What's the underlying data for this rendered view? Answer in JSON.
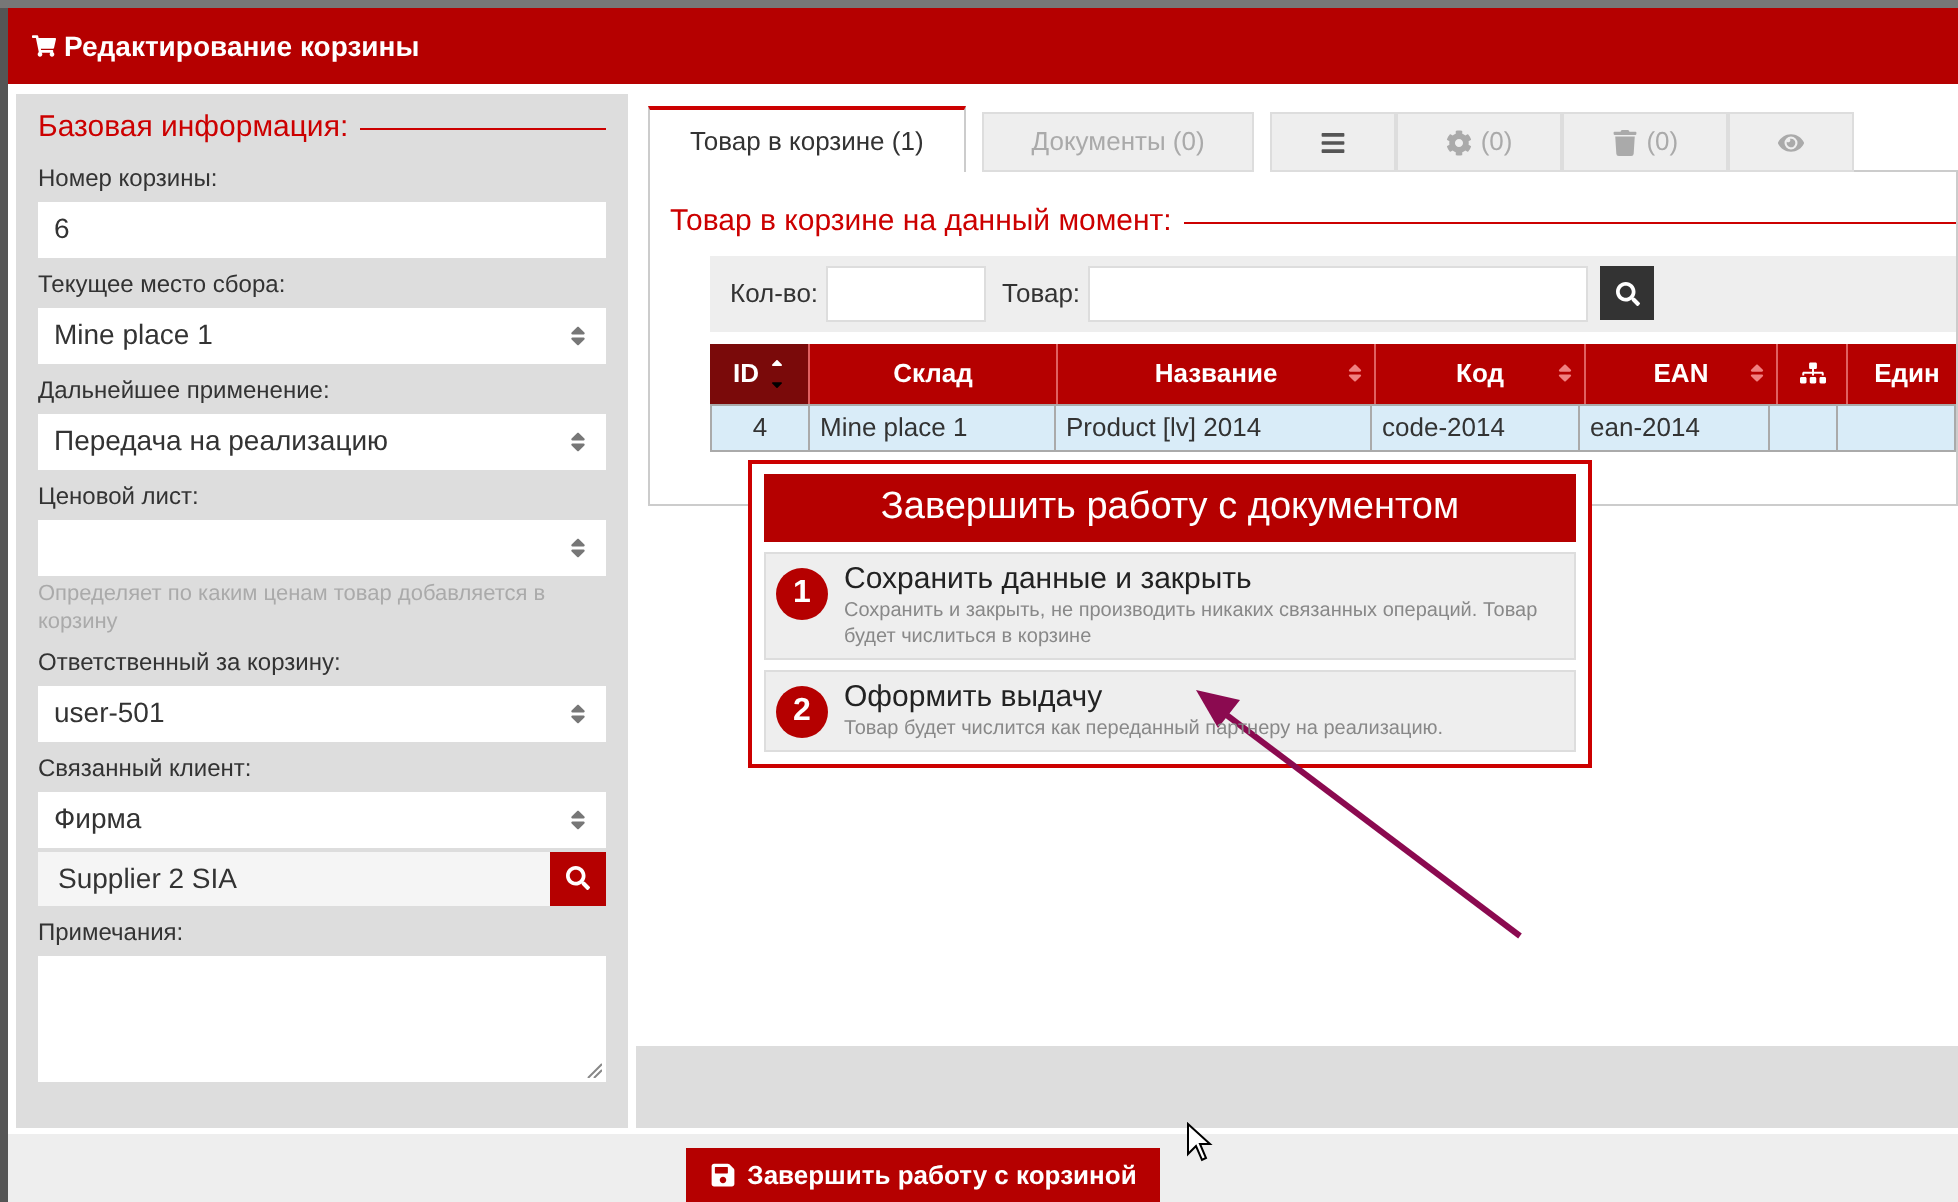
{
  "window": {
    "title": "Редактирование корзины"
  },
  "basic_info": {
    "heading": "Базовая информация:",
    "fields": [
      {
        "kind": "input",
        "label": "Номер корзины:",
        "value": "6"
      },
      {
        "kind": "select",
        "label": "Текущее место сбора:",
        "value": "Mine place 1"
      },
      {
        "kind": "select",
        "label": "Дальнейшее применение:",
        "value": "Передача на реализацию"
      },
      {
        "kind": "select",
        "label": "Ценовой лист:",
        "hint": "Определяет по каким ценам товар добавляется в корзину"
      },
      {
        "kind": "select",
        "label": "Ответственный за корзину:",
        "value": "user-501"
      },
      {
        "kind": "select",
        "label": "Связанный клиент:",
        "value": "Фирма"
      },
      {
        "kind": "lookup",
        "value": "Supplier 2 SIA"
      },
      {
        "kind": "textarea",
        "label": "Примечания:"
      }
    ]
  },
  "tabs": [
    {
      "kind": "text",
      "label": "Товар в корзине (1)",
      "selected": true
    },
    {
      "kind": "text",
      "label": "Документы (0)",
      "selected": false
    },
    {
      "kind": "icon",
      "selected": false
    },
    {
      "kind": "icon",
      "label": "(0)",
      "selected": false
    },
    {
      "kind": "icon",
      "label": "(0)",
      "selected": false
    },
    {
      "kind": "icon",
      "selected": false
    }
  ],
  "products": {
    "heading": "Товар в корзине на данный момент:",
    "filter": {
      "quantity_label": "Кол-во:",
      "product_label": "Товар:"
    },
    "table": {
      "columns": [
        {
          "label": "ID",
          "sorted": true,
          "sortable": true
        },
        {
          "label": "Склад",
          "sorted": false,
          "sortable": false
        },
        {
          "label": "Название",
          "sorted": false,
          "sortable": true
        },
        {
          "label": "Код",
          "sorted": false,
          "sortable": true
        },
        {
          "label": "EAN",
          "sorted": false,
          "sortable": true
        },
        {
          "kind": "icon",
          "sorted": false,
          "sortable": false
        },
        {
          "label": "Един",
          "sorted": false,
          "sortable": false
        }
      ],
      "rows": [
        [
          "4",
          "Mine place 1",
          "Product [lv] 2014",
          "code-2014",
          "ean-2014",
          "",
          ""
        ]
      ]
    }
  },
  "finish_dialog": {
    "title": "Завершить работу с документом",
    "options": [
      {
        "number": "1",
        "title": "Сохранить данные и закрыть",
        "description": "Сохранить и закрыть, не производить никаких связанных операций. Товар будет числиться в корзине"
      },
      {
        "number": "2",
        "title": "Оформить выдачу",
        "description": "Товар будет числится как переданный партнеру на реализацию."
      }
    ]
  },
  "footer": {
    "button": "Завершить работу с корзиной"
  }
}
